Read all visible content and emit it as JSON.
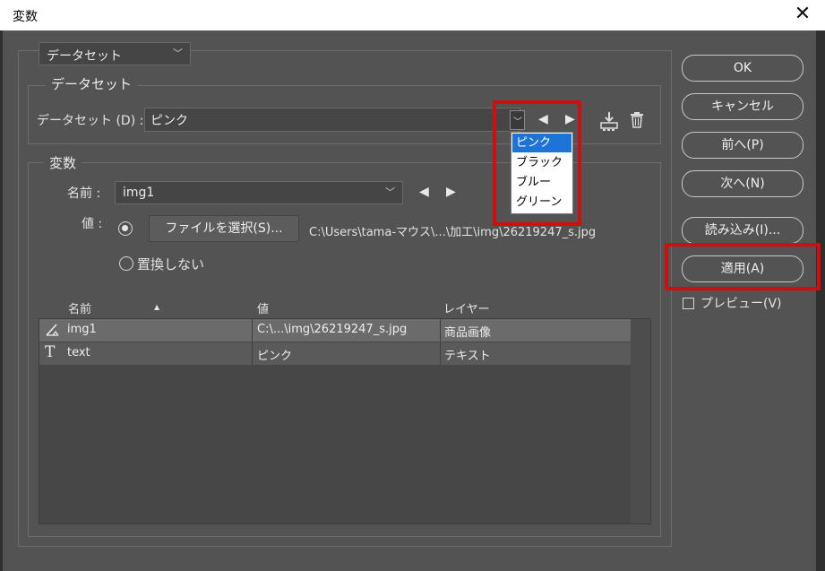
{
  "window": {
    "title": "変数"
  },
  "top_select": {
    "value": "データセット"
  },
  "dataset_group": {
    "title": "データセット",
    "label": "データセット (D) :",
    "value": "ピンク",
    "dropdown_options": [
      "ピンク",
      "ブラック",
      "ブルー",
      "グリーン"
    ],
    "selected_option": "ピンク"
  },
  "variables_group": {
    "title": "変数",
    "name_label": "名前 :",
    "name_value": "img1",
    "value_label": "値 :",
    "file_button": "ファイルを選択(S)...",
    "file_path": "C:\\Users\\tama-マウス\\...\\加工\\img\\26219247_s.jpg",
    "no_replace_label": "置換しない"
  },
  "table": {
    "headers": [
      "名前",
      "値",
      "レイヤー"
    ],
    "sort_indicator": "▲",
    "rows": [
      {
        "icon": "image-variable-icon",
        "name": "img1",
        "value": "C:\\...\\img\\26219247_s.jpg",
        "layer": "商品画像"
      },
      {
        "icon": "text-variable-icon",
        "name": "text",
        "value": "ピンク",
        "layer": "テキスト"
      }
    ]
  },
  "buttons": {
    "ok": "OK",
    "cancel": "キャンセル",
    "prev": "前へ(P)",
    "next": "次へ(N)",
    "load": "読み込み(I)...",
    "apply": "適用(A)"
  },
  "preview": {
    "label": "プレビュー(V)",
    "checked": false
  },
  "colors": {
    "highlight": "#d10d10",
    "dialog_bg": "#535353",
    "selection": "#1e73d6"
  }
}
